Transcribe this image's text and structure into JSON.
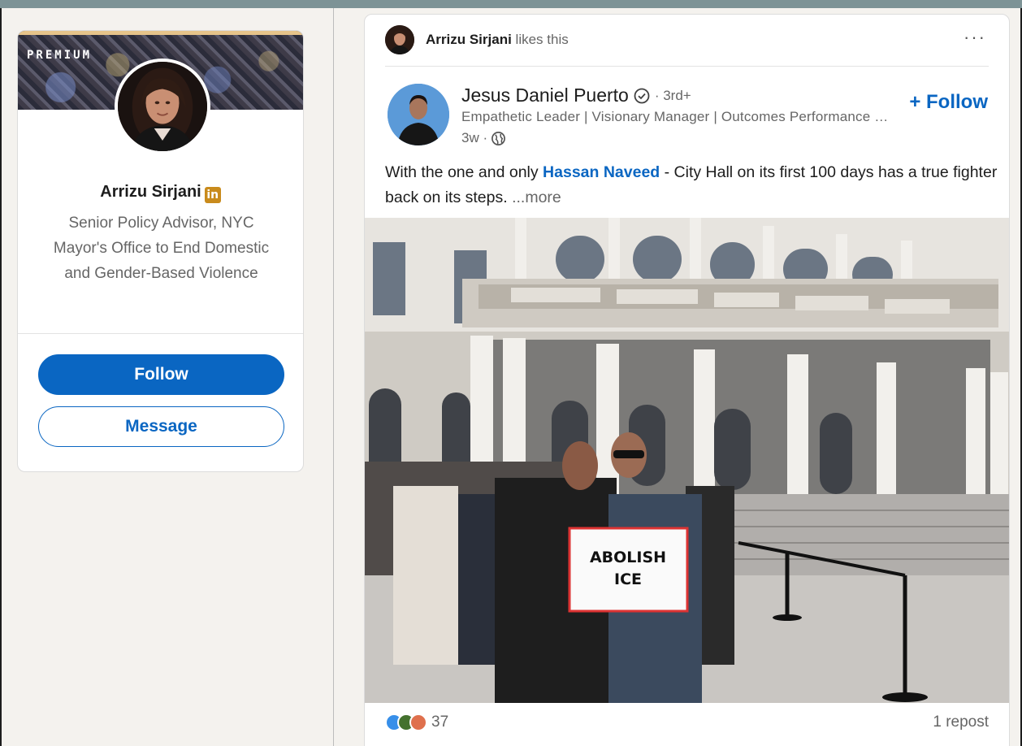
{
  "profile_card": {
    "premium_label": "PREMIUM",
    "name": "Arrizu Sirjani",
    "badge_icon": "linkedin-premium-icon",
    "headline": "Senior Policy Advisor, NYC Mayor's Office to End Domestic and Gender-Based Violence",
    "follow_label": "Follow",
    "message_label": "Message"
  },
  "feed_post": {
    "context": {
      "name": "Arrizu Sirjani",
      "action": "likes this"
    },
    "more_menu": "···",
    "actor": {
      "name": "Jesus Daniel Puerto",
      "verify_icon": "verified-shield-icon",
      "degree": "· 3rd+",
      "headline": "Empathetic Leader | Visionary Manager | Outcomes Performance Driven",
      "time": "3w ·",
      "visibility_icon": "globe-icon",
      "follow_label": "+ Follow"
    },
    "text": {
      "prefix": "With the one and only ",
      "mention": "Hassan Naveed",
      "suffix": " - City Hall on its first 100 days has a true fighter back on its steps. ",
      "see_more": " ...more"
    },
    "image": {
      "sign_line1": "ABOLISH",
      "sign_line2": "ICE"
    },
    "social": {
      "reactions_count": "37",
      "reposts": "1 repost"
    }
  },
  "colors": {
    "linkedin_blue": "#0a66c2",
    "premium_gold": "#c98b1c"
  }
}
